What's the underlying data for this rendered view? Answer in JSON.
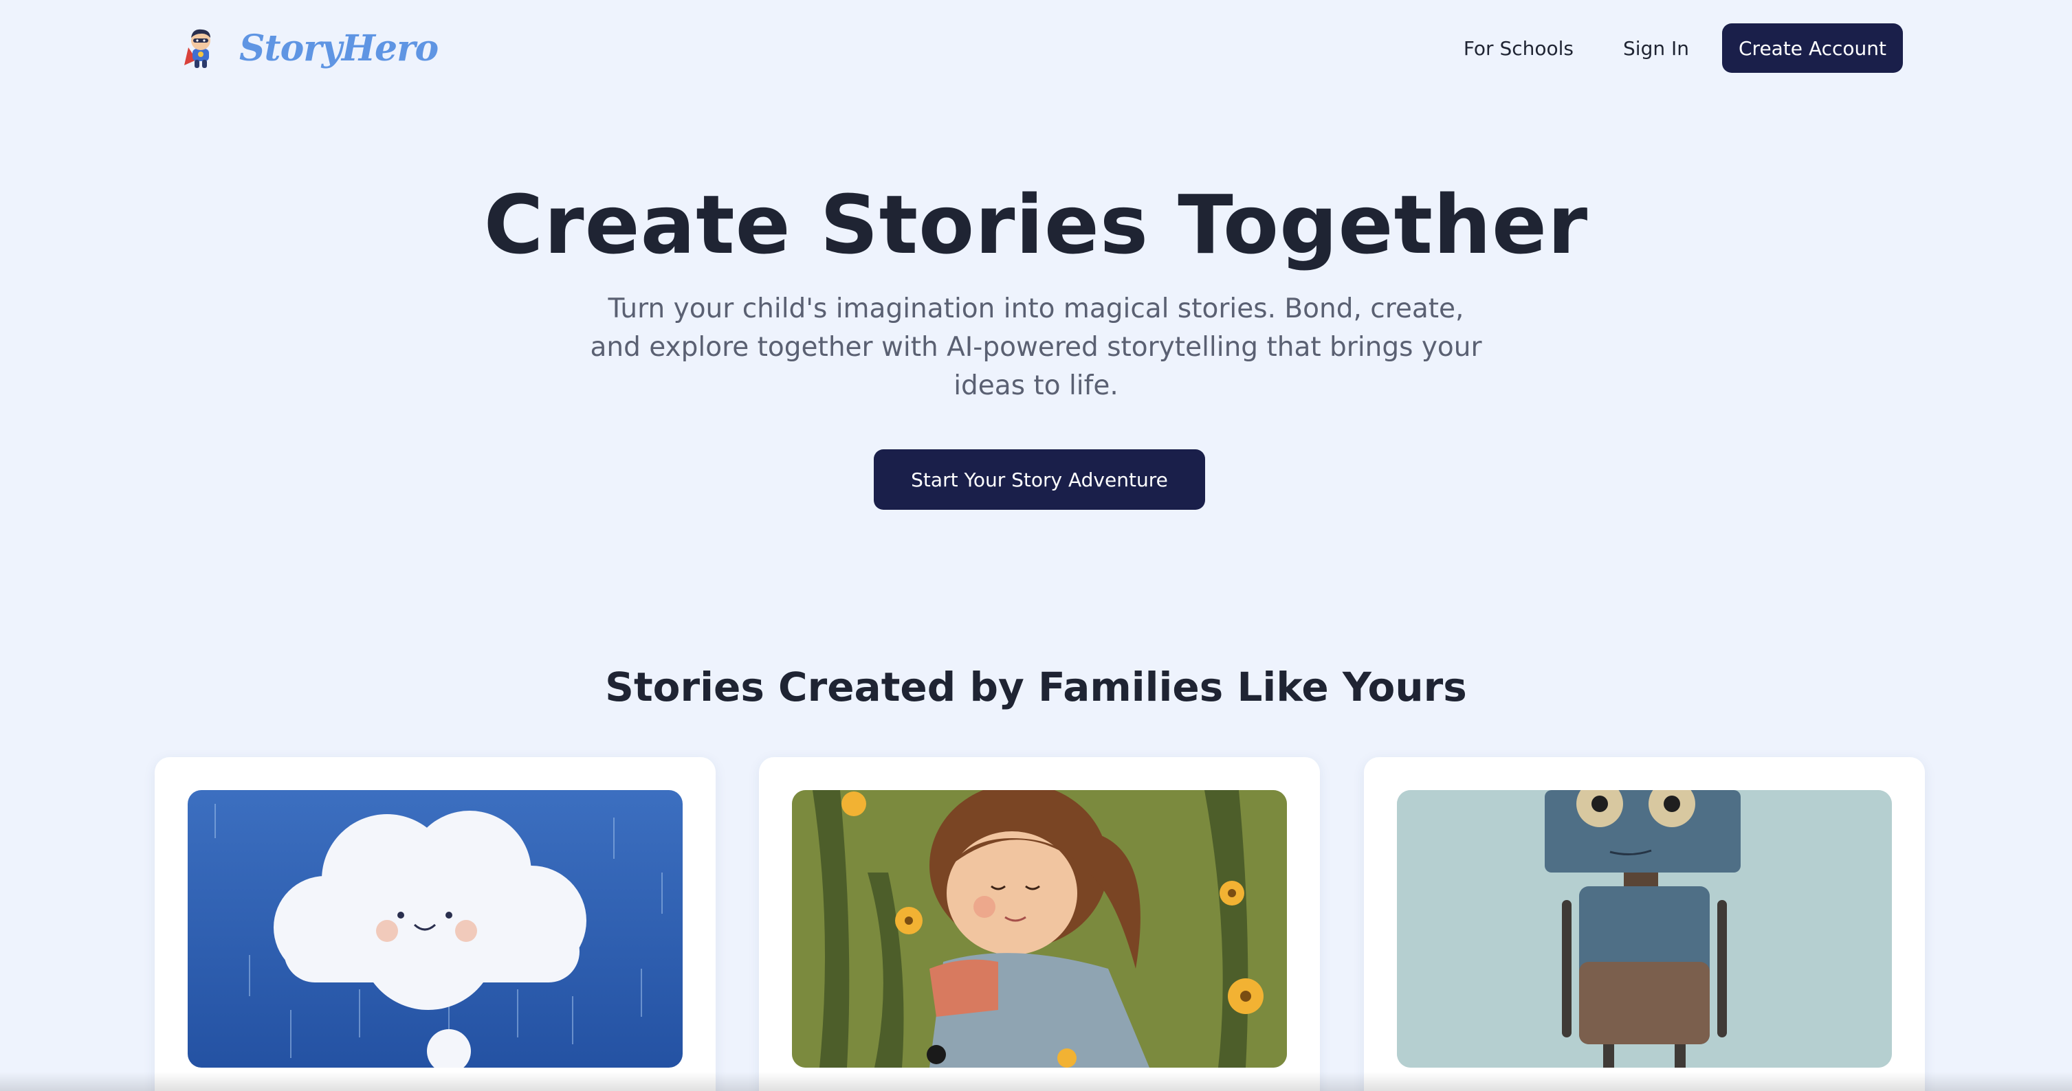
{
  "header": {
    "brand": "StoryHero",
    "logo_icon": "superhero-kid-icon",
    "nav": {
      "for_schools": "For Schools",
      "sign_in": "Sign In",
      "create_account": "Create Account"
    }
  },
  "hero": {
    "title": "Create Stories Together",
    "subtitle": "Turn your child's imagination into magical stories. Bond, create, and explore together with AI-powered storytelling that brings your ideas to life.",
    "cta": "Start Your Story Adventure"
  },
  "stories": {
    "title": "Stories Created by Families Like Yours",
    "cards": [
      {
        "image": "smiling-cloud-in-rain-illustration"
      },
      {
        "image": "girl-among-flowers-illustration"
      },
      {
        "image": "rusty-robot-illustration"
      }
    ]
  },
  "colors": {
    "background": "#eef3fd",
    "brand": "#5f95e3",
    "primary_button": "#1a1f4a",
    "heading": "#1f2433",
    "body_text": "#5a6072"
  }
}
